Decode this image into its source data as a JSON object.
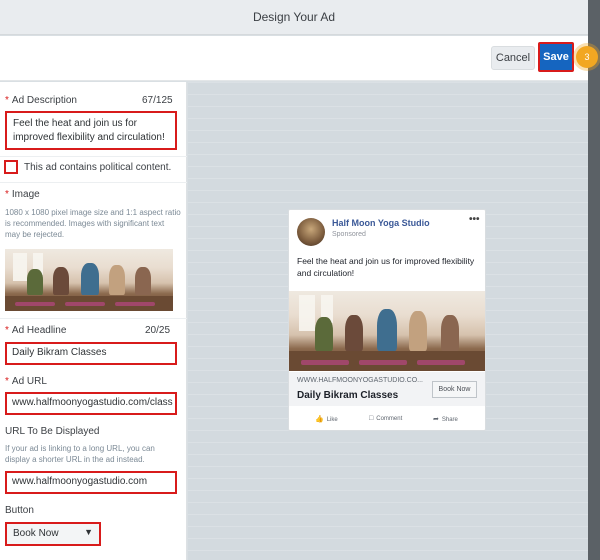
{
  "window": {
    "title": "Design Your Ad"
  },
  "toolbar": {
    "cancel_label": "Cancel",
    "save_label": "Save",
    "step_number": "3"
  },
  "form": {
    "description": {
      "label": "Ad Description",
      "counter": "67/125",
      "value": "Feel the heat and join us for improved flexibility and circulation!"
    },
    "political": {
      "label": "This ad contains political content.",
      "checked": false
    },
    "image": {
      "label": "Image",
      "help": "1080 x 1080 pixel image size and 1:1 aspect ratio is recommended. Images with significant text may be rejected."
    },
    "headline": {
      "label": "Ad Headline",
      "counter": "20/25",
      "value": "Daily Bikram Classes"
    },
    "url": {
      "label": "Ad URL",
      "value": "www.halfmoonyogastudio.com/class"
    },
    "display_url": {
      "label": "URL To Be Displayed",
      "help": "If your ad is linking to a long URL, you can display a shorter URL in the ad instead.",
      "value": "www.halfmoonyogastudio.com"
    },
    "button": {
      "label": "Button",
      "selected": "Book Now"
    }
  },
  "preview": {
    "page_name": "Half Moon Yoga Studio",
    "sponsored": "Sponsored",
    "more": "•••",
    "text": "Feel the heat and join us for improved flexibility and circulation!",
    "link_url": "WWW.HALFMOONYOGASTUDIO.CO...",
    "link_title": "Daily Bikram Classes",
    "cta": "Book Now",
    "actions": {
      "like": "Like",
      "comment": "Comment",
      "share": "Share"
    }
  },
  "colors": {
    "accent": "#1565c0",
    "highlight": "#d81b1b",
    "step_badge": "#f2a722",
    "fb_blue": "#3b5998"
  }
}
